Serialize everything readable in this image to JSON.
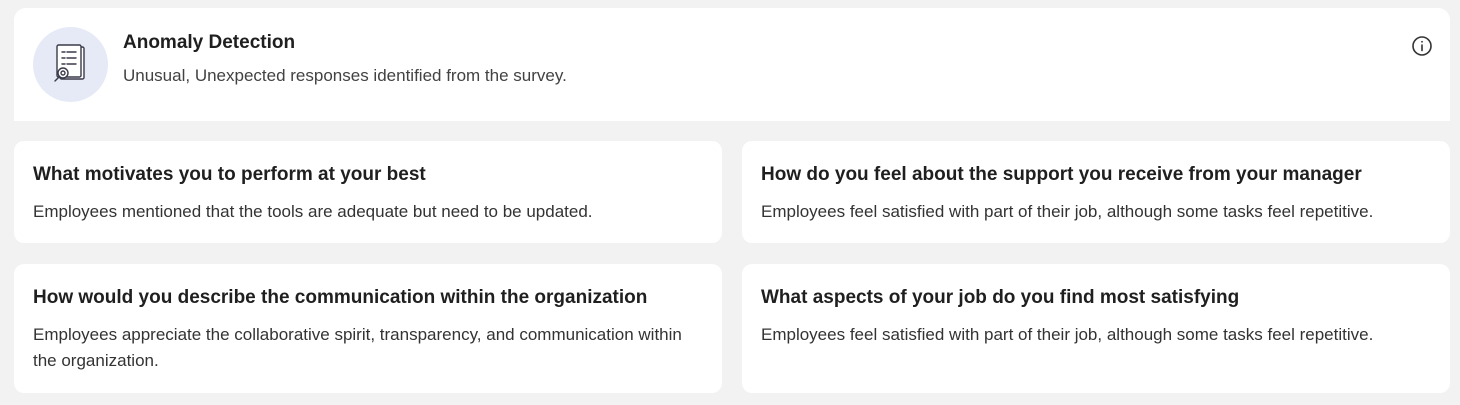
{
  "header": {
    "title": "Anomaly Detection",
    "subtitle": "Unusual, Unexpected responses identified from the survey.",
    "icon": "survey-document-icon",
    "info_icon": "info-icon",
    "icon_bg_color": "#e6eaf7"
  },
  "cards": [
    {
      "title": "What motivates you to perform at your best",
      "text": "Employees mentioned that the tools are adequate but need to be updated."
    },
    {
      "title": "How do you feel about the support you receive from your manager",
      "text": "Employees feel satisfied with part of their job, although some tasks feel repetitive."
    },
    {
      "title": "How would you describe the communication within the organization",
      "text": "Employees appreciate the collaborative spirit, transparency, and communication within the organization."
    },
    {
      "title": "What aspects of your job do you find most satisfying",
      "text": "Employees feel satisfied with part of their job, although some tasks feel repetitive."
    }
  ],
  "colors": {
    "page_background": "#f2f2f2",
    "card_background": "#ffffff",
    "text_primary": "#1f1f1f"
  }
}
